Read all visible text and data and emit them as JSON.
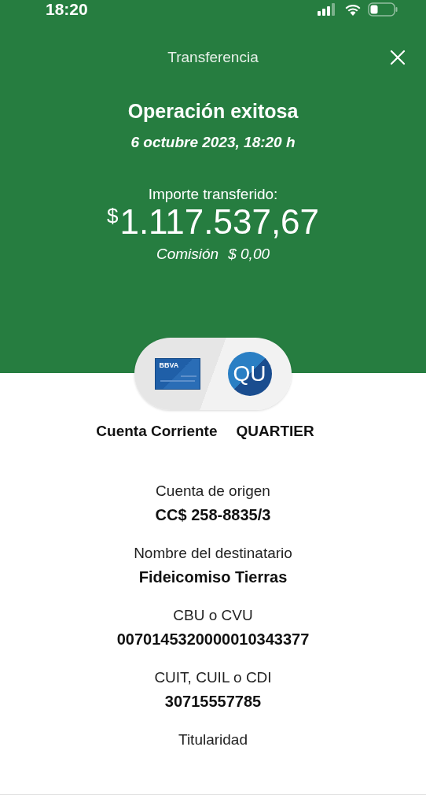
{
  "status_bar": {
    "time": "18:20"
  },
  "header": {
    "title": "Transferencia"
  },
  "result": {
    "heading": "Operación exitosa",
    "date": "6 octubre 2023, 18:20 h",
    "amount_label": "Importe transferido:",
    "currency_symbol": "$",
    "amount": "1.117.537,67",
    "fee_label": "Comisión",
    "fee": "$ 0,00"
  },
  "parties": [
    {
      "kind": "card",
      "logo": "BBVA",
      "label": "Cuenta Corriente"
    },
    {
      "kind": "avatar",
      "logo": "QU",
      "label": "QUARTIER"
    }
  ],
  "details": [
    {
      "label": "Cuenta de origen",
      "value": "CC$ 258-8835/3"
    },
    {
      "label": "Nombre del destinatario",
      "value": "Fideicomiso Tierras"
    },
    {
      "label": "CBU o CVU",
      "value": "0070145320000010343377"
    },
    {
      "label": "CUIT, CUIL o CDI",
      "value": "30715557785"
    },
    {
      "label": "Titularidad"
    }
  ]
}
